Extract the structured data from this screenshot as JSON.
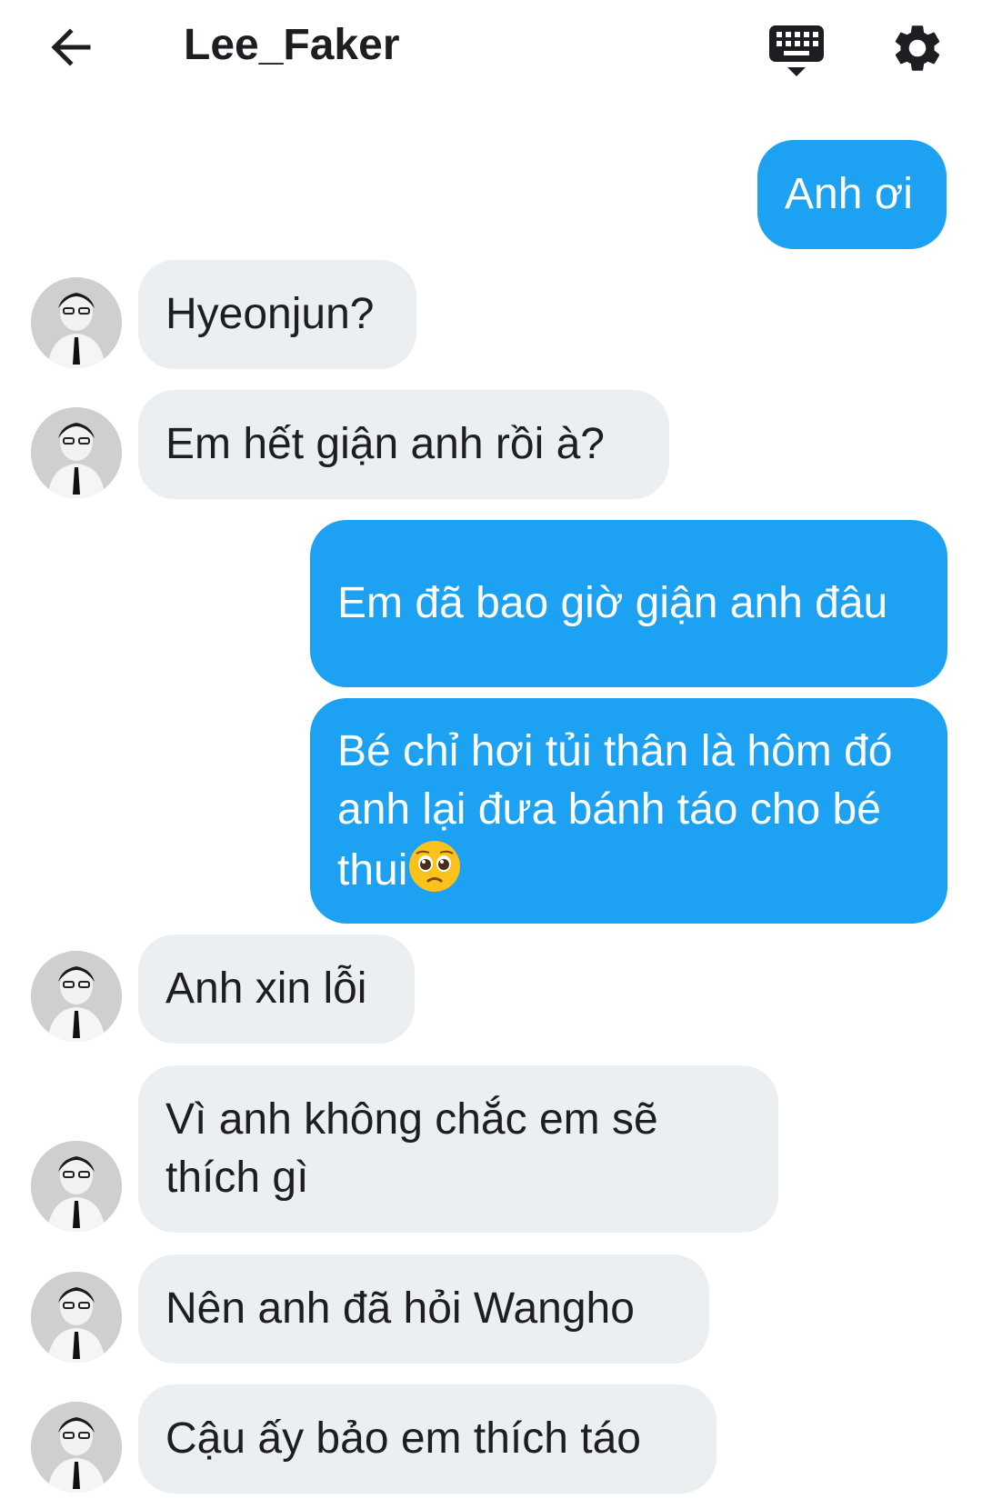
{
  "header": {
    "title": "Lee_Faker",
    "back_icon": "arrow-left-icon",
    "keyboard_icon": "keyboard-icon",
    "settings_icon": "gear-icon"
  },
  "colors": {
    "outgoing_bubble": "#1da1f2",
    "incoming_bubble": "#eceff2",
    "text_dark": "#1c1e21"
  },
  "messages": [
    {
      "direction": "outgoing",
      "text": "Anh ơi"
    },
    {
      "direction": "incoming",
      "text": "Hyeonjun?"
    },
    {
      "direction": "incoming",
      "text": "Em hết giận anh rồi à?"
    },
    {
      "direction": "outgoing",
      "text": "Em đã bao giờ giận anh đâu"
    },
    {
      "direction": "outgoing",
      "text": "Bé chỉ hơi tủi thân là hôm đó anh lại đưa bánh táo cho bé thui",
      "emoji": "pleading-face-emoji"
    },
    {
      "direction": "incoming",
      "text": "Anh xin lỗi"
    },
    {
      "direction": "incoming",
      "text": "Vì anh không chắc em sẽ thích gì"
    },
    {
      "direction": "incoming",
      "text": "Nên anh đã hỏi Wangho"
    },
    {
      "direction": "incoming",
      "text": "Cậu ấy bảo em thích táo"
    }
  ]
}
